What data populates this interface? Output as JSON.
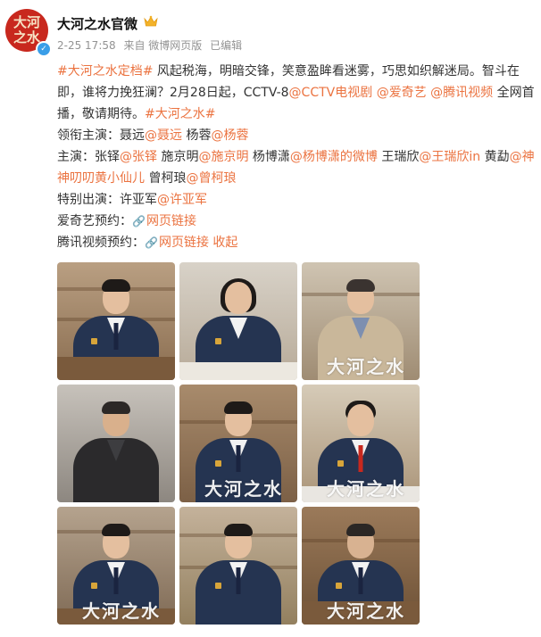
{
  "post": {
    "avatar_text": "大河之水",
    "username": "大河之水官微",
    "date": "2-25 17:58",
    "source": "来自 微博网页版",
    "edited": "已编辑"
  },
  "content": {
    "line1": {
      "tag": "#大河之水定档#",
      "text": " 风起税海，明暗交锋，笑意盈眸看迷雾，巧思如织解迷局。智斗在即，谁将力挽狂澜？2月28日起，CCTV-8",
      "mention1": "@CCTV电视剧",
      "sep1": " ",
      "mention2": "@爱奇艺",
      "sep2": " ",
      "mention3": "@腾讯视频",
      "text2": " 全网首播，敬请期待。",
      "tag2": "#大河之水#"
    },
    "lead": {
      "label": "领衔主演：聂远",
      "mention1": "@聂远",
      "text": " 杨蓉",
      "mention2": "@杨蓉"
    },
    "main_cast": {
      "label": "主演：张铎",
      "m1": "@张铎",
      "t1": " 施京明",
      "m2": "@施京明",
      "t2": " 杨博潇",
      "m3": "@杨博潇的微博",
      "t3": " 王瑞欣",
      "m4": "@王瑞欣in",
      "t4": " 黄勐",
      "m5": "@神神叨叨黄小仙儿",
      "t5": " 曾柯琅",
      "m6": "@曾柯琅"
    },
    "special": {
      "label": "特别出演：许亚军",
      "mention": "@许亚军"
    },
    "iqiyi": {
      "label": "爱奇艺预约：",
      "link": "网页链接"
    },
    "tencent": {
      "label": "腾讯视频预约：",
      "link": "网页链接",
      "collapse": "收起"
    }
  },
  "photos": {
    "watermark": "大河之水"
  },
  "colors": {
    "link": "#eb7340",
    "avatar_bg": "#c8281e",
    "verified": "#3a9ee8"
  },
  "icons": {
    "crown": "crown-icon",
    "verified": "verified-icon",
    "link": "link-icon",
    "chevron": "chevron-down-icon"
  }
}
